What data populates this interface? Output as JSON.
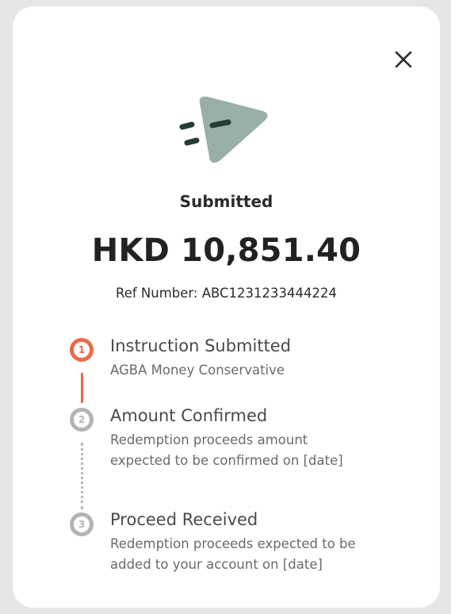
{
  "dialog": {
    "status_title": "Submitted",
    "amount": "HKD 10,851.40",
    "ref_label": "Ref Number:",
    "ref_value": "ABC1231233444224",
    "close_icon": "close-icon",
    "hero_icon": "paper-plane-send-icon",
    "colors": {
      "accent": "#ea6a4a",
      "inactive": "#b3b3b3",
      "plane_body": "#9aafa6",
      "plane_lines": "#233e36"
    }
  },
  "steps": [
    {
      "number": "1",
      "title": "Instruction Submitted",
      "desc_lines": [
        "AGBA Money Conservative"
      ],
      "state": "completed"
    },
    {
      "number": "2",
      "title": "Amount Confirmed",
      "desc_lines": [
        "Redemption proceeds amount",
        "expected to be confirmed on [date]"
      ],
      "state": "pending"
    },
    {
      "number": "3",
      "title": "Proceed Received",
      "desc_lines": [
        "Redemption proceeds expected to be",
        "added to your account on [date]"
      ],
      "state": "pending"
    }
  ]
}
